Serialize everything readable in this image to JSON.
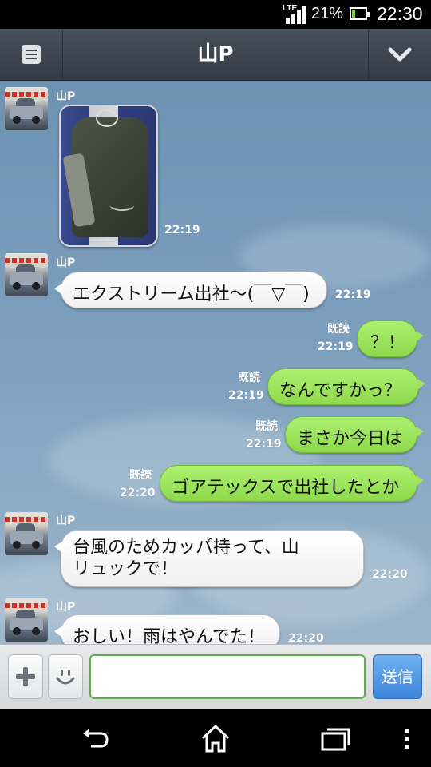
{
  "status_bar": {
    "network": "LTE",
    "battery": "21%",
    "time": "22:30"
  },
  "header": {
    "title": "山P"
  },
  "messages": [
    {
      "kind": "photo",
      "sender": "山P",
      "time": "22:19"
    },
    {
      "kind": "in",
      "sender": "山P",
      "text": "エクストリーム出社〜(￣▽￣)",
      "time": "22:19"
    },
    {
      "kind": "out",
      "read": "既読",
      "text": "？！",
      "time": "22:19"
    },
    {
      "kind": "out",
      "read": "既読",
      "text": "なんですかっ？",
      "time": "22:19"
    },
    {
      "kind": "out",
      "read": "既読",
      "text": "まさか今日は",
      "time": "22:19"
    },
    {
      "kind": "out",
      "read": "既読",
      "text": "ゴアテックスで出社したとか",
      "time": "22:20"
    },
    {
      "kind": "in",
      "sender": "山P",
      "lines": [
        "台風のためカッパ持って、山",
        "リュックで！"
      ],
      "time": "22:20"
    },
    {
      "kind": "in",
      "sender": "山P",
      "text": "おしい！雨はやんでた！",
      "time": "22:20"
    }
  ],
  "input_bar": {
    "send_label": "送信",
    "placeholder": ""
  },
  "colors": {
    "incoming_bubble": "#ffffff",
    "outgoing_bubble": "#9fe45f",
    "header": "#3d444d",
    "send_button": "#4a90e2"
  }
}
